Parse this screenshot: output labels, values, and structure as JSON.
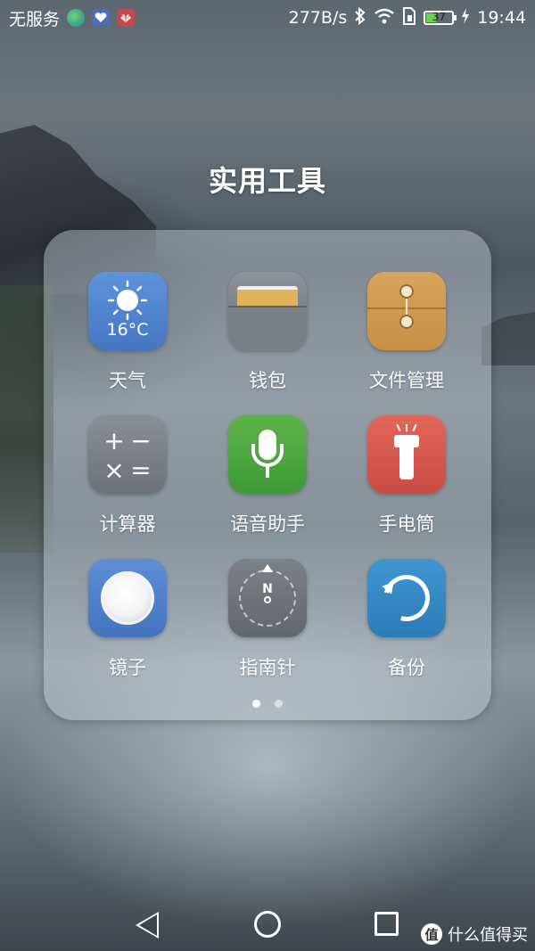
{
  "status_bar": {
    "carrier": "无服务",
    "net_speed": "277B/s",
    "battery_level": "37",
    "battery_fraction": 0.37,
    "time": "19:44",
    "colors": {
      "battery_fill": "#6bd14a"
    }
  },
  "folder": {
    "title": "实用工具",
    "apps": [
      {
        "label": "天气",
        "icon": "weather-icon",
        "temp": "16°C",
        "color": "#4f83cf"
      },
      {
        "label": "钱包",
        "icon": "wallet-icon",
        "color": "#7b8188"
      },
      {
        "label": "文件管理",
        "icon": "file-manager-icon",
        "color": "#cf9a50"
      },
      {
        "label": "计算器",
        "icon": "calculator-icon",
        "calc_symbols": [
          "+",
          "−",
          "×",
          "="
        ],
        "color": "#7c8187"
      },
      {
        "label": "语音助手",
        "icon": "microphone-icon",
        "color": "#4ea640"
      },
      {
        "label": "手电筒",
        "icon": "flashlight-icon",
        "color": "#d5594e"
      },
      {
        "label": "镜子",
        "icon": "mirror-icon",
        "color": "#4f82cb"
      },
      {
        "label": "指南针",
        "icon": "compass-icon",
        "compass_letter": "N",
        "color": "#6e7379"
      },
      {
        "label": "备份",
        "icon": "backup-icon",
        "color": "#358ac4"
      }
    ],
    "page_count": 2,
    "current_page": 1
  },
  "navbar": {
    "buttons": [
      "back-icon",
      "home-icon",
      "recents-icon"
    ]
  },
  "watermark": {
    "logo_char": "值",
    "text": "什么值得买"
  }
}
